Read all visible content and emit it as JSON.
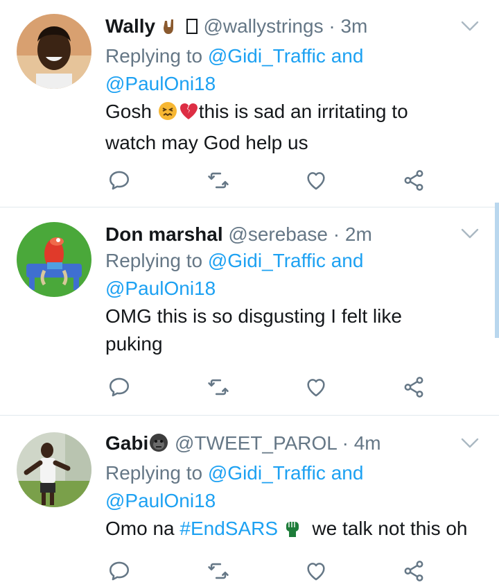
{
  "tweets": [
    {
      "display_name": "Wally",
      "handle": "@wallystrings",
      "time": "· 3m",
      "replying_prefix": "Replying to",
      "reply_to_1": "@Gidi_Traffic",
      "reply_and": "and",
      "reply_to_2": "@PaulOni18",
      "text_prefix": "Gosh",
      "text_line1": "this is sad an irritating to",
      "text_line2": "watch may God help us",
      "name_emojis": [
        "sign-of-horns-emoji",
        "missing-glyph"
      ]
    },
    {
      "display_name": "Don marshal",
      "handle": "@serebase",
      "time": "· 2m",
      "replying_prefix": "Replying to",
      "reply_to_1": "@Gidi_Traffic",
      "reply_and": "and",
      "reply_to_2": "@PaulOni18",
      "text_line1": "OMG this is so disgusting I felt like",
      "text_line2": "puking"
    },
    {
      "display_name": "Gabi",
      "handle": "@TWEET_PAROL",
      "time": "· 4m",
      "replying_prefix": "Replying to",
      "reply_to_1": "@Gidi_Traffic",
      "reply_and": "and",
      "reply_to_2": "@PaulOni18",
      "text_prefix": "Omo na",
      "hashtag": "#EndSARS",
      "text_suffix": "we talk not this oh",
      "name_emojis": [
        "gorilla-emoji"
      ]
    }
  ],
  "icons": {
    "reply": "reply-icon",
    "retweet": "retweet-icon",
    "like": "like-icon",
    "share": "share-icon",
    "menu": "chevron-down-icon"
  },
  "colors": {
    "link": "#1da1f2",
    "muted": "#657786",
    "text": "#14171a",
    "icon": "#657786",
    "divider": "#e1e8ed"
  }
}
